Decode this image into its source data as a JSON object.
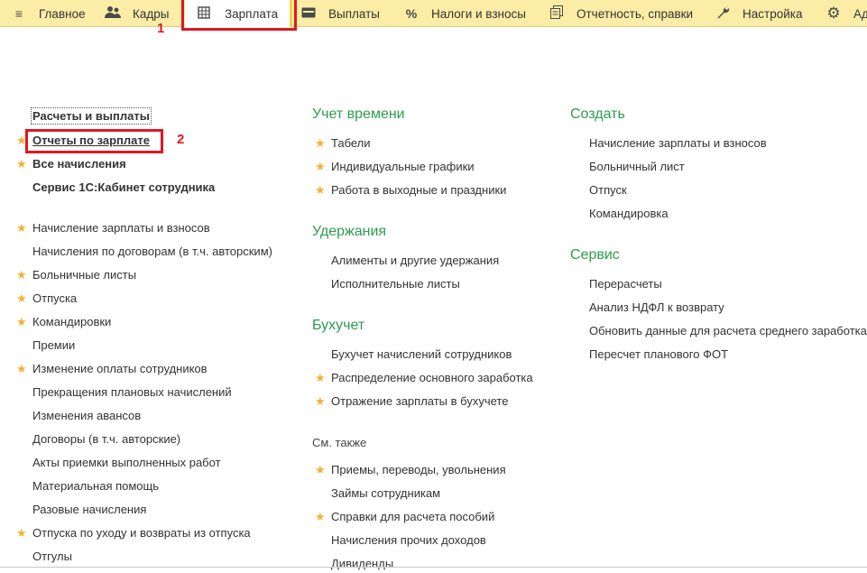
{
  "menu": {
    "tabs": [
      {
        "label": "Главное",
        "icon": "hamburger-icon"
      },
      {
        "label": "Кадры",
        "icon": "people-icon"
      },
      {
        "label": "Зарплата",
        "icon": "calculator-icon",
        "active": true
      },
      {
        "label": "Выплаты",
        "icon": "wallet-icon"
      },
      {
        "label": "Налоги и взносы",
        "icon": "percent-icon"
      },
      {
        "label": "Отчетность, справки",
        "icon": "documents-icon"
      },
      {
        "label": "Настройка",
        "icon": "wrench-icon"
      },
      {
        "label": "Ад",
        "icon": "gear-icon"
      }
    ]
  },
  "annotations": {
    "callout1": "1",
    "callout2": "2",
    "annotation_color": "#e0171f"
  },
  "left": {
    "top_items": [
      {
        "label": "Расчеты и выплаты",
        "starred": false
      },
      {
        "label": "Отчеты по зарплате",
        "starred": true
      },
      {
        "label": "Все начисления",
        "starred": true
      },
      {
        "label": "Сервис 1С:Кабинет сотрудника",
        "starred": false
      }
    ],
    "items": [
      {
        "label": "Начисление зарплаты и взносов",
        "starred": true
      },
      {
        "label": "Начисления по договорам (в т.ч. авторским)",
        "starred": false
      },
      {
        "label": "Больничные листы",
        "starred": true
      },
      {
        "label": "Отпуска",
        "starred": true
      },
      {
        "label": "Командировки",
        "starred": true
      },
      {
        "label": "Премии",
        "starred": false
      },
      {
        "label": "Изменение оплаты сотрудников",
        "starred": true
      },
      {
        "label": "Прекращения плановых начислений",
        "starred": false
      },
      {
        "label": "Изменения авансов",
        "starred": false
      },
      {
        "label": "Договоры (в т.ч. авторские)",
        "starred": false
      },
      {
        "label": "Акты приемки выполненных работ",
        "starred": false
      },
      {
        "label": "Материальная помощь",
        "starred": false
      },
      {
        "label": "Разовые начисления",
        "starred": false
      },
      {
        "label": "Отпуска по уходу и возвраты из отпуска",
        "starred": true
      },
      {
        "label": "Отгулы",
        "starred": false
      }
    ]
  },
  "middle": {
    "sections": [
      {
        "title": "Учет времени",
        "items": [
          {
            "label": "Табели",
            "starred": true
          },
          {
            "label": "Индивидуальные графики",
            "starred": true
          },
          {
            "label": "Работа в выходные и праздники",
            "starred": true
          }
        ]
      },
      {
        "title": "Удержания",
        "items": [
          {
            "label": "Алименты и другие удержания",
            "starred": false
          },
          {
            "label": "Исполнительные листы",
            "starred": false
          }
        ]
      },
      {
        "title": "Бухучет",
        "items": [
          {
            "label": "Бухучет начислений сотрудников",
            "starred": false
          },
          {
            "label": "Распределение основного заработка",
            "starred": true
          },
          {
            "label": "Отражение зарплаты в бухучете",
            "starred": true
          }
        ]
      }
    ],
    "see_also": {
      "title": "См. также",
      "items": [
        {
          "label": "Приемы, переводы, увольнения",
          "starred": true
        },
        {
          "label": "Займы сотрудникам",
          "starred": false
        },
        {
          "label": "Справки для расчета пособий",
          "starred": true
        },
        {
          "label": "Начисления прочих доходов",
          "starred": false
        },
        {
          "label": "Дивиденды",
          "starred": false
        }
      ]
    }
  },
  "right": {
    "sections": [
      {
        "title": "Создать",
        "items": [
          {
            "label": "Начисление зарплаты и взносов"
          },
          {
            "label": "Больничный лист"
          },
          {
            "label": "Отпуск"
          },
          {
            "label": "Командировка"
          }
        ]
      },
      {
        "title": "Сервис",
        "items": [
          {
            "label": "Перерасчеты"
          },
          {
            "label": "Анализ НДФЛ к возврату"
          },
          {
            "label": "Обновить данные для расчета среднего заработка"
          },
          {
            "label": "Пересчет планового ФОТ"
          }
        ]
      }
    ]
  },
  "colors": {
    "menu_bg": "#fbeda6",
    "section_title": "#2c9c4e",
    "star": "#f2b133"
  }
}
